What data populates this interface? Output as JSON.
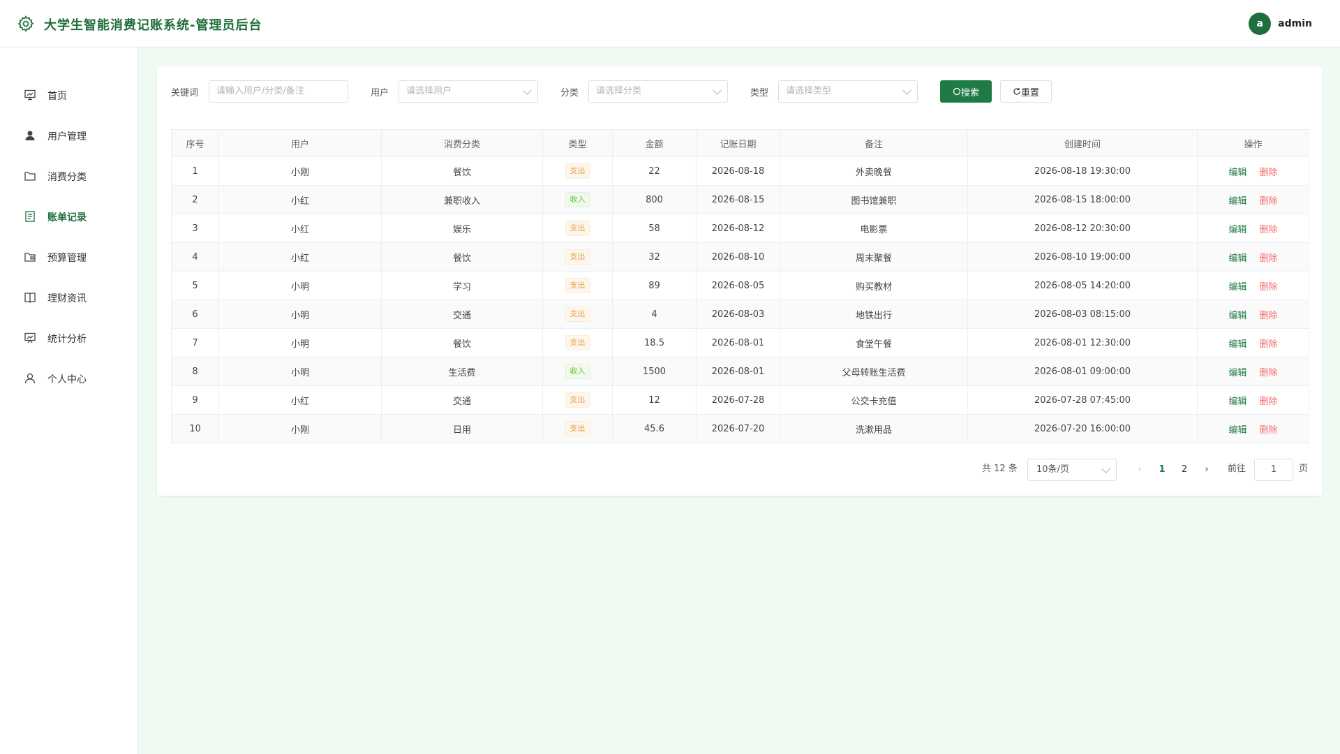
{
  "header": {
    "title": "大学生智能消费记账系统-管理员后台",
    "avatar_letter": "a",
    "username": "admin"
  },
  "sidebar": {
    "items": [
      {
        "label": "首页",
        "icon": "chart-board-icon"
      },
      {
        "label": "用户管理",
        "icon": "user-icon"
      },
      {
        "label": "消费分类",
        "icon": "folder-icon"
      },
      {
        "label": "账单记录",
        "icon": "document-icon",
        "active": true
      },
      {
        "label": "预算管理",
        "icon": "wallet-icon"
      },
      {
        "label": "理财资讯",
        "icon": "book-icon"
      },
      {
        "label": "统计分析",
        "icon": "presentation-icon"
      },
      {
        "label": "个人中心",
        "icon": "person-icon"
      }
    ]
  },
  "filters": {
    "keyword_label": "关键词",
    "keyword_placeholder": "请输入用户/分类/备注",
    "user_label": "用户",
    "user_placeholder": "请选择用户",
    "category_label": "分类",
    "category_placeholder": "请选择分类",
    "type_label": "类型",
    "type_placeholder": "请选择类型",
    "search_label": "搜索",
    "reset_label": "重置"
  },
  "table": {
    "headers": [
      "序号",
      "用户",
      "消费分类",
      "类型",
      "金额",
      "记账日期",
      "备注",
      "创建时间",
      "操作"
    ],
    "edit_label": "编辑",
    "delete_label": "删除",
    "rows": [
      {
        "no": "1",
        "user": "小刚",
        "category": "餐饮",
        "type": "支出",
        "kind": "expense",
        "amount": "22",
        "date": "2026-08-18",
        "note": "外卖晚餐",
        "created": "2026-08-18 19:30:00"
      },
      {
        "no": "2",
        "user": "小红",
        "category": "兼职收入",
        "type": "收入",
        "kind": "income",
        "amount": "800",
        "date": "2026-08-15",
        "note": "图书馆兼职",
        "created": "2026-08-15 18:00:00"
      },
      {
        "no": "3",
        "user": "小红",
        "category": "娱乐",
        "type": "支出",
        "kind": "expense",
        "amount": "58",
        "date": "2026-08-12",
        "note": "电影票",
        "created": "2026-08-12 20:30:00"
      },
      {
        "no": "4",
        "user": "小红",
        "category": "餐饮",
        "type": "支出",
        "kind": "expense",
        "amount": "32",
        "date": "2026-08-10",
        "note": "周末聚餐",
        "created": "2026-08-10 19:00:00"
      },
      {
        "no": "5",
        "user": "小明",
        "category": "学习",
        "type": "支出",
        "kind": "expense",
        "amount": "89",
        "date": "2026-08-05",
        "note": "购买教材",
        "created": "2026-08-05 14:20:00"
      },
      {
        "no": "6",
        "user": "小明",
        "category": "交通",
        "type": "支出",
        "kind": "expense",
        "amount": "4",
        "date": "2026-08-03",
        "note": "地铁出行",
        "created": "2026-08-03 08:15:00"
      },
      {
        "no": "7",
        "user": "小明",
        "category": "餐饮",
        "type": "支出",
        "kind": "expense",
        "amount": "18.5",
        "date": "2026-08-01",
        "note": "食堂午餐",
        "created": "2026-08-01 12:30:00"
      },
      {
        "no": "8",
        "user": "小明",
        "category": "生活费",
        "type": "收入",
        "kind": "income",
        "amount": "1500",
        "date": "2026-08-01",
        "note": "父母转账生活费",
        "created": "2026-08-01 09:00:00"
      },
      {
        "no": "9",
        "user": "小红",
        "category": "交通",
        "type": "支出",
        "kind": "expense",
        "amount": "12",
        "date": "2026-07-28",
        "note": "公交卡充值",
        "created": "2026-07-28 07:45:00"
      },
      {
        "no": "10",
        "user": "小刚",
        "category": "日用",
        "type": "支出",
        "kind": "expense",
        "amount": "45.6",
        "date": "2026-07-20",
        "note": "洗漱用品",
        "created": "2026-07-20 16:00:00"
      }
    ]
  },
  "pagination": {
    "total_text": "共 12 条",
    "page_size": "10条/页",
    "pages": [
      "1",
      "2"
    ],
    "current": "1",
    "goto_label": "前往",
    "goto_value": "1",
    "page_suffix": "页"
  },
  "colors": {
    "brand": "#1f6e3d",
    "primary_button": "#1f7a44",
    "delete": "#f56c6c",
    "expense_tag": "#e6a23c",
    "income_tag": "#67c23a",
    "content_bg": "#eefaf2"
  }
}
